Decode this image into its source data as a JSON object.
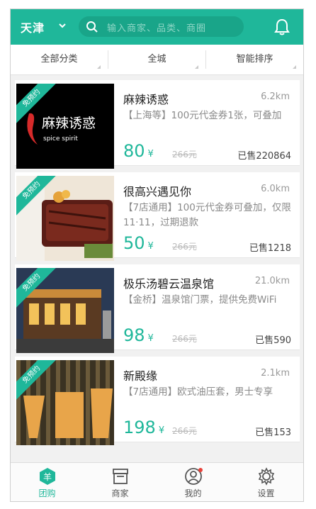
{
  "header": {
    "city": "天津",
    "search_placeholder": "输入商家、品类、商圈",
    "accent": "#1fb79a"
  },
  "filters": [
    "全部分类",
    "全城",
    "智能排序"
  ],
  "deals": [
    {
      "name": "麻辣诱惑",
      "distance": "6.2km",
      "desc": "【上海等】100元代金券1张，可叠加",
      "price": "80",
      "currency": "¥",
      "original": "266元",
      "sold": "已售220864",
      "badge": "免预约",
      "logo_text": "麻辣诱惑",
      "logo_sub": "spice spirit"
    },
    {
      "name": "很高兴遇见你",
      "distance": "6.0km",
      "desc": "【7店通用】100元代金券可叠加，仅限11·11，过期退款",
      "price": "50",
      "currency": "¥",
      "original": "266元",
      "sold": "已售1218",
      "badge": "免预约"
    },
    {
      "name": "极乐汤碧云温泉馆",
      "distance": "21.0km",
      "desc": "【金桥】温泉馆门票，提供免费WiFi",
      "price": "98",
      "currency": "¥",
      "original": "266元",
      "sold": "已售590",
      "badge": "免预约"
    },
    {
      "name": "新殿缘",
      "distance": "2.1km",
      "desc": "【7店通用】欧式油压套，男士专享",
      "price": "198",
      "currency": "¥",
      "original": "266元",
      "sold": "已售153",
      "badge": "免预约"
    }
  ],
  "tabs": [
    {
      "label": "团购",
      "icon": "groupbuy-icon",
      "active": true
    },
    {
      "label": "商家",
      "icon": "store-icon",
      "active": false
    },
    {
      "label": "我的",
      "icon": "profile-icon",
      "active": false
    },
    {
      "label": "设置",
      "icon": "gear-icon",
      "active": false
    }
  ]
}
